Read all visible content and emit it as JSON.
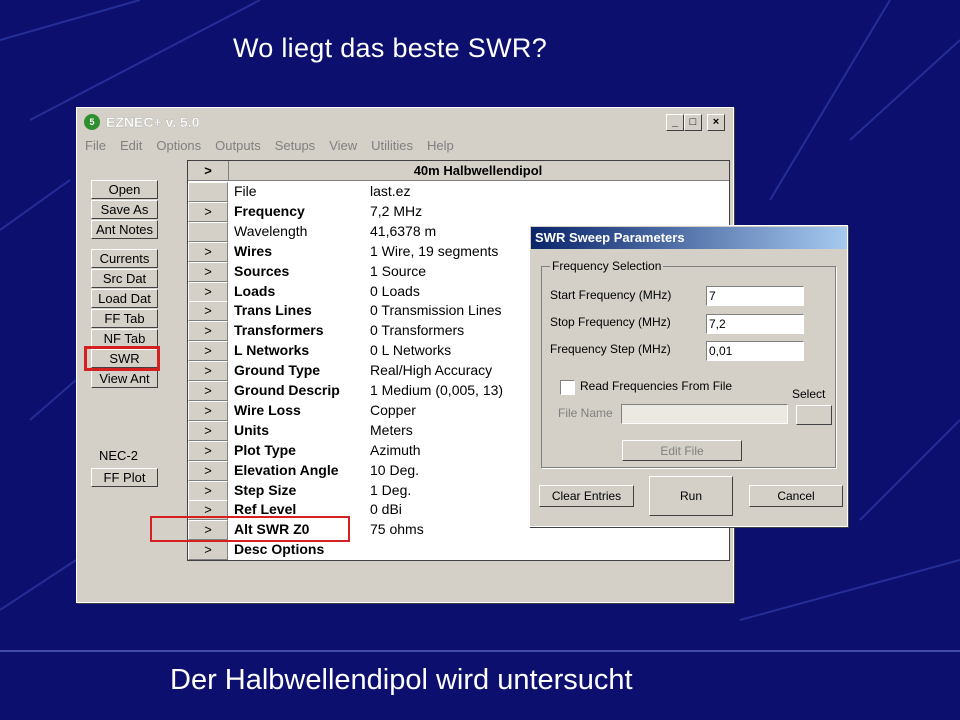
{
  "slide": {
    "title": "Wo liegt das beste SWR?",
    "caption": "Der Halbwellendipol wird untersucht",
    "background_color": "#0d0f6e",
    "highlight_color": "#d42020"
  },
  "eznec": {
    "window_title": "EZNEC+  v. 5.0",
    "icon": "eznec-app-icon",
    "window_buttons": [
      "_",
      "□",
      "×"
    ],
    "menu": [
      "File",
      "Edit",
      "Options",
      "Outputs",
      "Setups",
      "View",
      "Utilities",
      "Help"
    ],
    "buttons": {
      "open": "Open",
      "save_as": "Save As",
      "ant_notes": "Ant Notes",
      "currents": "Currents",
      "src_dat": "Src Dat",
      "load_dat": "Load Dat",
      "ff_tab": "FF Tab",
      "nf_tab": "NF Tab",
      "swr": "SWR",
      "view_ant": "View Ant",
      "ff_plot": "FF Plot"
    },
    "nec_label": "NEC-2",
    "grid_header_arrow": ">",
    "grid_title": "40m Halbwellendipol",
    "rows": [
      {
        "arrow": "",
        "label": "File",
        "value": "last.ez",
        "bold": false
      },
      {
        "arrow": ">",
        "label": "Frequency",
        "value": "7,2 MHz",
        "bold": true
      },
      {
        "arrow": "",
        "label": "Wavelength",
        "value": "41,6378 m",
        "bold": false
      },
      {
        "arrow": ">",
        "label": "Wires",
        "value": "1 Wire, 19 segments",
        "bold": true
      },
      {
        "arrow": ">",
        "label": "Sources",
        "value": "1 Source",
        "bold": true
      },
      {
        "arrow": ">",
        "label": "Loads",
        "value": "0 Loads",
        "bold": true
      },
      {
        "arrow": ">",
        "label": "Trans Lines",
        "value": "0 Transmission Lines",
        "bold": true
      },
      {
        "arrow": ">",
        "label": "Transformers",
        "value": "0 Transformers",
        "bold": true
      },
      {
        "arrow": ">",
        "label": "L Networks",
        "value": "0 L Networks",
        "bold": true
      },
      {
        "arrow": ">",
        "label": "Ground Type",
        "value": "Real/High Accuracy",
        "bold": true
      },
      {
        "arrow": ">",
        "label": "Ground Descrip",
        "value": "1 Medium (0,005, 13)",
        "bold": true
      },
      {
        "arrow": ">",
        "label": "Wire Loss",
        "value": "Copper",
        "bold": true
      },
      {
        "arrow": ">",
        "label": "Units",
        "value": "Meters",
        "bold": true
      },
      {
        "arrow": ">",
        "label": "Plot Type",
        "value": "Azimuth",
        "bold": true
      },
      {
        "arrow": ">",
        "label": "Elevation Angle",
        "value": "10 Deg.",
        "bold": true
      },
      {
        "arrow": ">",
        "label": "Step Size",
        "value": "1 Deg.",
        "bold": true
      },
      {
        "arrow": ">",
        "label": "Ref Level",
        "value": "0 dBi",
        "bold": true
      },
      {
        "arrow": ">",
        "label": "Alt SWR Z0",
        "value": "75 ohms",
        "bold": true
      },
      {
        "arrow": ">",
        "label": "Desc Options",
        "value": "",
        "bold": true
      }
    ]
  },
  "swr_dialog": {
    "title": "SWR Sweep Parameters",
    "group_label": "Frequency Selection",
    "start_label": "Start Frequency (MHz)",
    "start_value": "7",
    "stop_label": "Stop Frequency (MHz)",
    "stop_value": "7,2",
    "step_label": "Frequency Step (MHz)",
    "step_value": "0,01",
    "read_from_file_label": "Read Frequencies From File",
    "read_from_file_checked": false,
    "select_label": "Select",
    "file_name_label": "File Name",
    "file_name_value": "",
    "edit_file_label": "Edit File",
    "clear_label": "Clear Entries",
    "run_label": "Run",
    "cancel_label": "Cancel"
  }
}
